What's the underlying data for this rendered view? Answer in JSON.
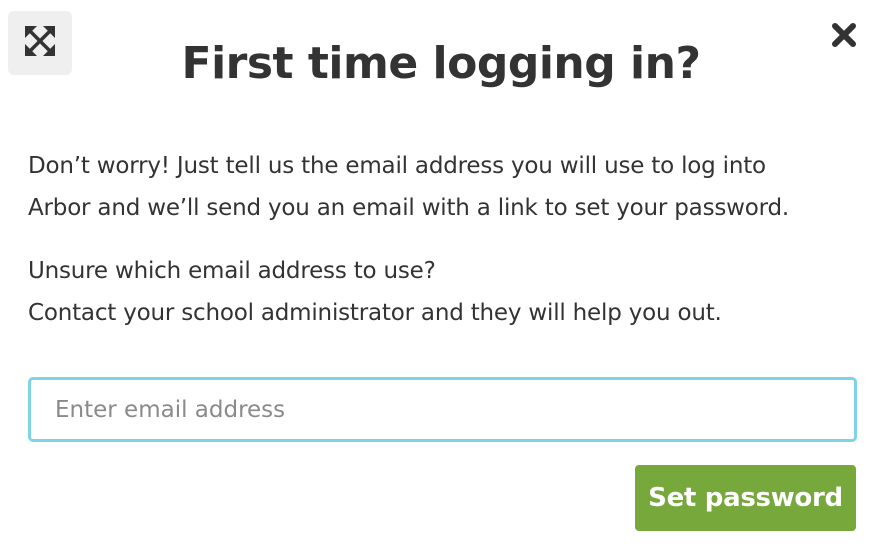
{
  "dialog": {
    "title": "First time logging in?",
    "paragraph1": {
      "line1": "Don’t worry! Just tell us the email address you will use to log into",
      "line2": "Arbor and we’ll send you an email with a link to set your password."
    },
    "paragraph2": {
      "line1": "Unsure which email address to use?",
      "line2": "Contact your school administrator and they will help you out."
    },
    "email_input": {
      "placeholder": "Enter email address",
      "value": ""
    },
    "submit_label": "Set password",
    "icons": {
      "expand": "expand-arrows-icon",
      "close": "close-icon"
    },
    "colors": {
      "button": "#76a83b",
      "input_focus_border": "#7fd3e6",
      "text": "#333333"
    }
  }
}
